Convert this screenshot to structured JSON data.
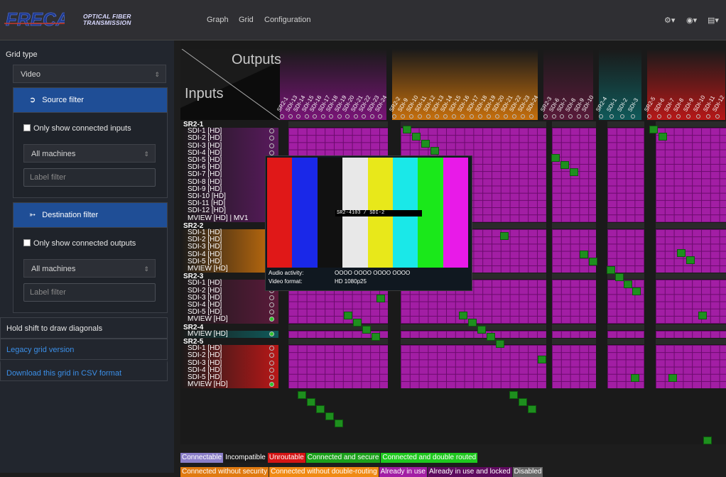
{
  "navbar": {
    "brand_line1": "OPTICAL FIBER",
    "brand_line2": "TRANSMISSION",
    "links": [
      "Graph",
      "Grid",
      "Configuration"
    ],
    "right_icons": [
      "gears-icon",
      "user-icon",
      "language-icon"
    ]
  },
  "sidebar": {
    "grid_type_label": "Grid type",
    "grid_type_value": "Video",
    "source_filter_title": "Source filter",
    "only_connected_inputs": "Only show connected inputs",
    "source_machines": "All machines",
    "source_label_placeholder": "Label filter",
    "destination_filter_title": "Destination filter",
    "only_connected_outputs": "Only show connected outputs",
    "dest_machines": "All machines",
    "dest_label_placeholder": "Label filter",
    "shift_hint": "Hold shift to draw diagonals",
    "legacy_link": "Legacy grid version",
    "csv_link": "Download this grid in CSV format"
  },
  "grid": {
    "outputs_label": "Outputs",
    "inputs_label": "Inputs",
    "row_groups": [
      {
        "title": "SR2-1",
        "rows": [
          "SDI-1 [HD]",
          "SDI-2 [HD]",
          "SDI-3 [HD]",
          "SDI-4 [HD]",
          "SDI-5 [HD]",
          "SDI-6 [HD]",
          "SDI-7 [HD]",
          "SDI-8 [HD]",
          "SDI-9 [HD]",
          "SDI-10 [HD]",
          "SDI-11 [HD]",
          "SDI-12 [HD]",
          "MVIEW [HD] | MV1"
        ]
      },
      {
        "title": "SR2-2",
        "rows": [
          "SDI-1 [HD]",
          "SDI-2 [HD]",
          "SDI-3 [HD]",
          "SDI-4 [HD]",
          "SDI-5 [HD]",
          "MVIEW [HD]"
        ]
      },
      {
        "title": "SR2-3",
        "rows": [
          "SDI-1 [HD]",
          "SDI-2 [HD]",
          "SDI-3 [HD]",
          "SDI-4 [HD]",
          "SDI-5 [HD]",
          "MVIEW [HD]"
        ]
      },
      {
        "title": "SR2-4",
        "rows": [
          "MVIEW [HD]"
        ]
      },
      {
        "title": "SR2-5",
        "rows": [
          "SDI-1 [HD]",
          "SDI-2 [HD]",
          "SDI-3 [HD]",
          "SDI-4 [HD]",
          "SDI-5 [HD]",
          "MVIEW [HD]"
        ]
      }
    ],
    "col_groups": [
      {
        "name": "SR2-1",
        "color": "#7a1478",
        "cols": [
          "SDI-13",
          "SDI-14",
          "SDI-15",
          "SDI-16",
          "SDI-17",
          "SDI-18",
          "SDI-19",
          "SDI-20",
          "SDI-21",
          "SDI-22",
          "SDI-23",
          "SDI-24"
        ]
      },
      {
        "name": "SR2-2",
        "color": "#c8700c",
        "cols": [
          "SDI-9",
          "SDI-10",
          "SDI-11",
          "SDI-12",
          "SDI-13",
          "SDI-14",
          "SDI-15",
          "SDI-16",
          "SDI-17",
          "SDI-18",
          "SDI-19",
          "SDI-20",
          "SDI-21",
          "SDI-22",
          "SDI-23",
          "SDI-24"
        ]
      },
      {
        "name": "SR2-3",
        "color": "#5a1a3a",
        "cols": [
          "SDI-6",
          "SDI-7",
          "SDI-8",
          "SDI-9",
          "SDI-10"
        ]
      },
      {
        "name": "SR2-4",
        "color": "#0f5a5a",
        "cols": [
          "SDI-1",
          "SDI-2",
          "SDI-3"
        ]
      },
      {
        "name": "SR2-5",
        "color": "#b81818",
        "cols": [
          "SDI-6",
          "SDI-7",
          "SDI-8",
          "SDI-9",
          "SDI-10",
          "SDI-11",
          "SDI-12"
        ]
      }
    ]
  },
  "preview": {
    "caption": "SR2-4103 / SDI-2",
    "audio_label": "Audio activity:",
    "audio_value": "OOOO OOOO OOOO OOOO",
    "video_label": "Video format:",
    "video_value": "HD 1080p25",
    "bar_colors": [
      "#e01818",
      "#1a28e8",
      "#111111",
      "#e8e8e8",
      "#e8e81a",
      "#1ae8e8",
      "#1ae81a",
      "#e81ae8"
    ]
  },
  "legend": {
    "row1": [
      {
        "label": "Connectable",
        "bg": "#8a7ec8"
      },
      {
        "label": "Incompatible",
        "bg": "#1a1a1a"
      },
      {
        "label": "Unroutable",
        "bg": "#d41414"
      },
      {
        "label": "Connected and secure",
        "bg": "#1aa01a"
      },
      {
        "label": "Connected and double routed",
        "bg": "#1ec81e"
      }
    ],
    "row2": [
      {
        "label": "Connected without security",
        "bg": "#e07a10"
      },
      {
        "label": "Connected without double-routing",
        "bg": "#f08a14"
      },
      {
        "label": "Already in use",
        "bg": "#a21ea4"
      },
      {
        "label": "Already in use and locked",
        "bg": "#5e0a5e"
      },
      {
        "label": "Disabled",
        "bg": "#666666"
      }
    ]
  }
}
